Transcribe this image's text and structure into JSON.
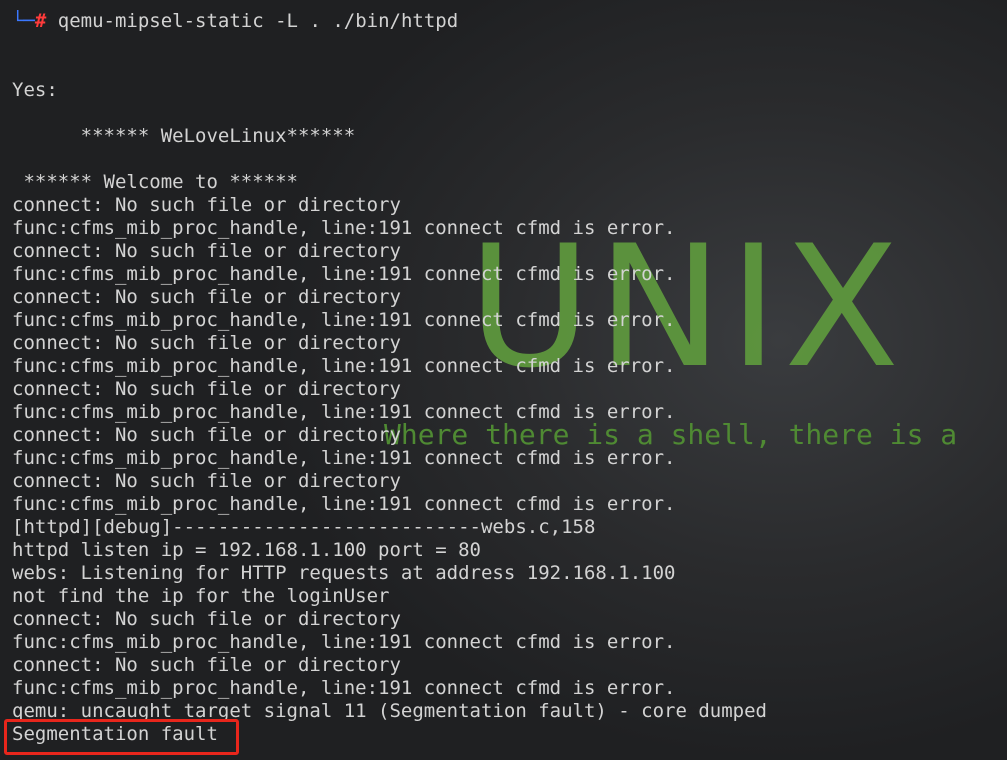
{
  "terminal": {
    "prompt_glyph": "└─",
    "prompt_hash": "#",
    "command": " qemu-mipsel-static -L . ./bin/httpd",
    "lines": [
      "",
      "",
      "Yes:",
      "",
      "      ****** WeLoveLinux******",
      "",
      " ****** Welcome to ******",
      "connect: No such file or directory",
      "func:cfms_mib_proc_handle, line:191 connect cfmd is error.",
      "connect: No such file or directory",
      "func:cfms_mib_proc_handle, line:191 connect cfmd is error.",
      "connect: No such file or directory",
      "func:cfms_mib_proc_handle, line:191 connect cfmd is error.",
      "connect: No such file or directory",
      "func:cfms_mib_proc_handle, line:191 connect cfmd is error.",
      "connect: No such file or directory",
      "func:cfms_mib_proc_handle, line:191 connect cfmd is error.",
      "connect: No such file or directory",
      "func:cfms_mib_proc_handle, line:191 connect cfmd is error.",
      "connect: No such file or directory",
      "func:cfms_mib_proc_handle, line:191 connect cfmd is error.",
      "[httpd][debug]---------------------------webs.c,158",
      "httpd listen ip = 192.168.1.100 port = 80",
      "webs: Listening for HTTP requests at address 192.168.1.100",
      "not find the ip for the loginUser",
      "connect: No such file or directory",
      "func:cfms_mib_proc_handle, line:191 connect cfmd is error.",
      "connect: No such file or directory",
      "func:cfms_mib_proc_handle, line:191 connect cfmd is error.",
      "qemu: uncaught target signal 11 (Segmentation fault) - core dumped",
      "Segmentation fault"
    ]
  },
  "wallpaper": {
    "word": "UNIX",
    "slogan": "Where there is a shell, there is a"
  },
  "colors": {
    "text": "#d3d3d3",
    "prompt_glyph": "#3b78ff",
    "prompt_hash": "#ff3b3b",
    "wallpaper_green": "#5f9a3e",
    "highlight_border": "#e8261c"
  }
}
